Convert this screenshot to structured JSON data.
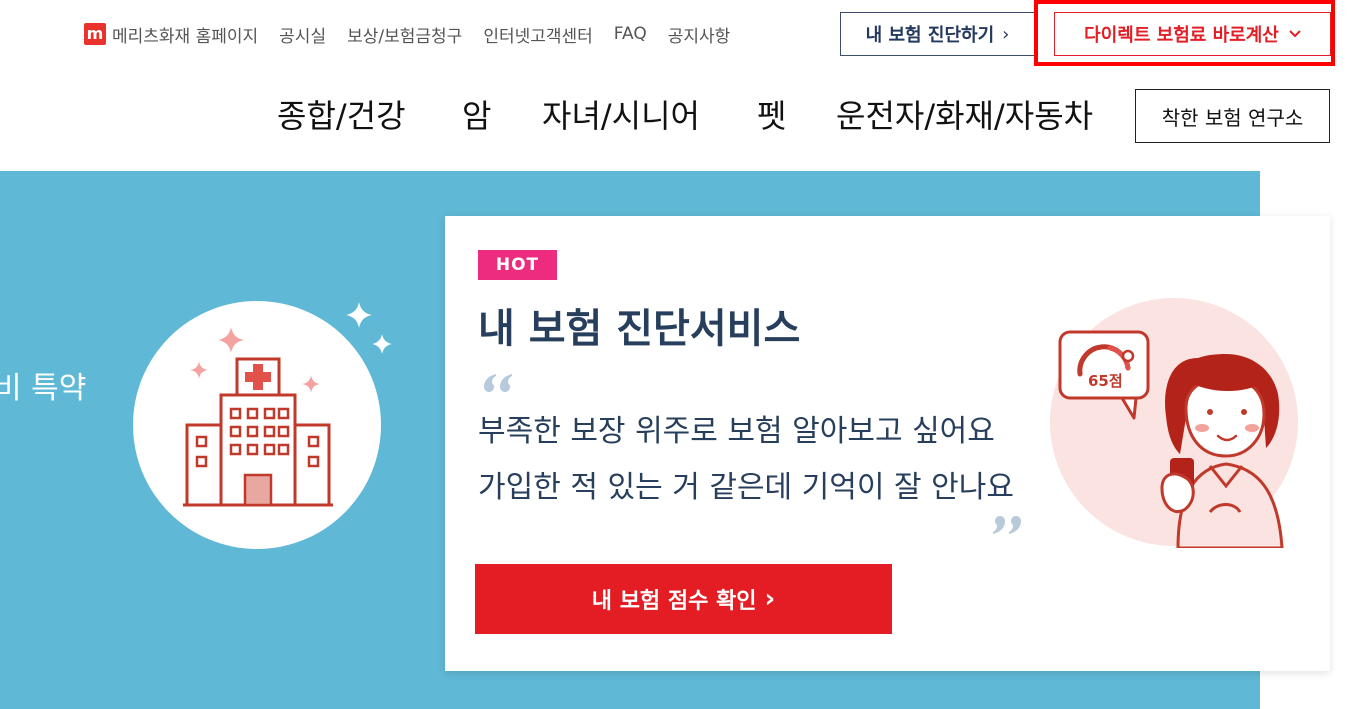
{
  "utility_nav": {
    "logo_letter": "m",
    "homepage_label": "메리츠화재 홈페이지",
    "items": [
      "공시실",
      "보상/보험금청구",
      "인터넷고객센터",
      "FAQ",
      "공지사항"
    ]
  },
  "header_buttons": {
    "diagnosis_label": "내 보험 진단하기",
    "diagnosis_chevron": "›",
    "direct_label": "다이렉트 보험료 바로계산",
    "direct_chevron": "⌄"
  },
  "main_nav": {
    "items": [
      "종합/건강",
      "암",
      "자녀/시니어",
      "펫",
      "운전자/화재/자동차"
    ],
    "lab_button": "착한 보험 연구소"
  },
  "hero": {
    "left_text_fragment": "비 특약",
    "card": {
      "badge": "HOT",
      "title": "내 보험 진단서비스",
      "lines": [
        "부족한 보장 위주로 보험 알아보고 싶어요",
        "가입한 적 있는 거 같은데 기억이 잘 안나요"
      ],
      "cta_label": "내 보험 점수 확인",
      "cta_chevron": "›",
      "score_text": "65점"
    }
  },
  "colors": {
    "brand_red": "#e31d23",
    "hero_blue": "#5fb8d6",
    "navy": "#273f5c",
    "hot_pink": "#ee2c7f",
    "highlight": "#ff0000"
  }
}
